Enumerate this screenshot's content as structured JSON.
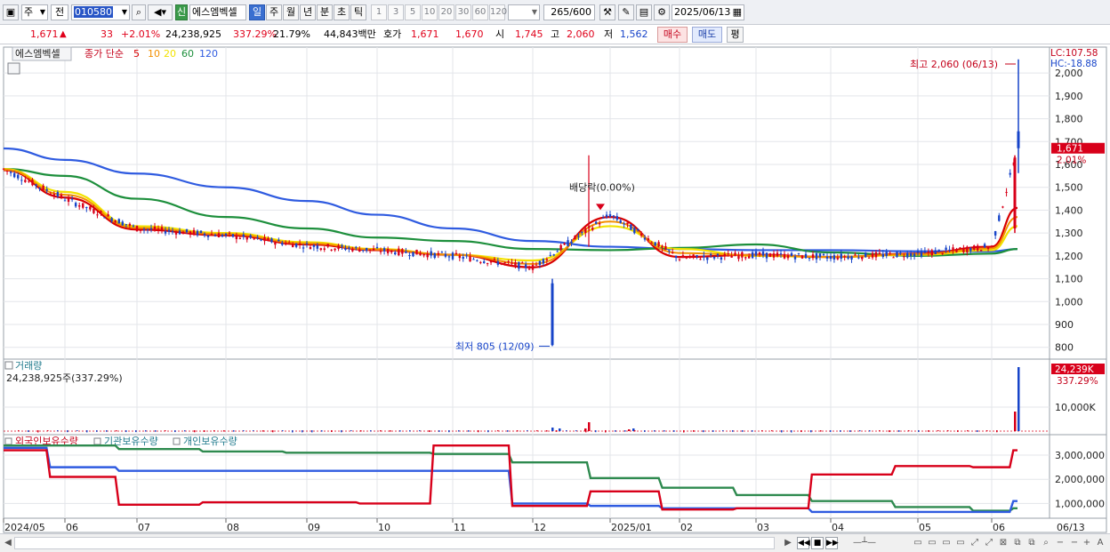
{
  "toolbar": {
    "market": "주",
    "scope": "전",
    "code": "010580",
    "badge": "신",
    "stock_name": "에스엠벡셀",
    "periods": [
      {
        "label": "일",
        "selected": true
      },
      {
        "label": "주",
        "selected": false
      },
      {
        "label": "월",
        "selected": false
      },
      {
        "label": "년",
        "selected": false
      },
      {
        "label": "분",
        "selected": false
      },
      {
        "label": "초",
        "selected": false
      },
      {
        "label": "틱",
        "selected": false
      }
    ],
    "intervals": [
      "1",
      "3",
      "5",
      "10",
      "20",
      "30",
      "60",
      "120"
    ],
    "count": "265/600",
    "date": "2025/06/13"
  },
  "quote": {
    "price": "1,671",
    "arrow": "▲",
    "change": "33",
    "change_pct": "+2.01%",
    "volume": "24,238,925",
    "volume_ratio": "337.29%",
    "turnover": "21.79%",
    "amount": "44,843백만",
    "ask_label": "호가",
    "ask": "1,671",
    "bid": "1,670",
    "open_label": "시",
    "open": "1,745",
    "high_label": "고",
    "high": "2,060",
    "low_label": "저",
    "low": "1,562",
    "buy_label": "매수",
    "sell_label": "매도",
    "avg_label": "평"
  },
  "colors": {
    "up": "#e0001a",
    "down": "#1744c9",
    "ma5": "#d80000",
    "ma10": "#f39000",
    "ma20": "#f2e200",
    "ma60": "#1d8f3c",
    "ma120": "#2f5be0"
  },
  "price_panel": {
    "legend_name": "에스엠벡셀",
    "legend_series": "종가 단순",
    "ma_periods": [
      "5",
      "10",
      "20",
      "60",
      "120"
    ],
    "lc": "LC:107.58",
    "hc": "HC:-18.88",
    "current_tag": "1,671",
    "current_pct": "2.01%",
    "high_note": "최고 2,060 (06/13)",
    "low_note": "최저 805 (12/09)",
    "dividend_note": "배당락(0.00%)",
    "y_ticks": [
      "2,000",
      "1,900",
      "1,800",
      "1,700",
      "1,600",
      "1,500",
      "1,400",
      "1,300",
      "1,200",
      "1,100",
      "1,000",
      "900",
      "800"
    ]
  },
  "volume_panel": {
    "title": "거래량",
    "summary": "24,238,925주(337.29%)",
    "tag": "24,239K",
    "tag_pct": "337.29%",
    "y_tick": "10,000K"
  },
  "holding_panel": {
    "legend": [
      "외국인보유수량",
      "기관보유수량",
      "개인보유수량"
    ],
    "y_ticks": [
      "3,000,000",
      "2,000,000",
      "1,000,000"
    ]
  },
  "x_axis": [
    "2024/05",
    "06",
    "07",
    "08",
    "09",
    "10",
    "11",
    "12",
    "2025/01",
    "02",
    "03",
    "04",
    "05",
    "06",
    "06/13"
  ],
  "chart_data": [
    {
      "type": "line",
      "name": "price",
      "x": [
        "2024/05",
        "06",
        "07",
        "08",
        "09",
        "10",
        "11",
        "12",
        "2025/01",
        "02",
        "03",
        "04",
        "05",
        "06",
        "06/13"
      ],
      "ylim": [
        760,
        2090
      ],
      "series": [
        {
          "name": "종가",
          "values": [
            1580,
            1450,
            1320,
            1290,
            1245,
            1225,
            1200,
            1150,
            1380,
            1190,
            1205,
            1195,
            1210,
            1240,
            1671
          ]
        },
        {
          "name": "5",
          "values": [
            1575,
            1455,
            1315,
            1290,
            1250,
            1225,
            1205,
            1150,
            1370,
            1195,
            1205,
            1195,
            1210,
            1240,
            1410
          ]
        },
        {
          "name": "20",
          "values": [
            1580,
            1480,
            1330,
            1300,
            1260,
            1230,
            1205,
            1180,
            1330,
            1230,
            1200,
            1195,
            1205,
            1225,
            1330
          ]
        },
        {
          "name": "60",
          "values": [
            1580,
            1550,
            1450,
            1370,
            1320,
            1280,
            1265,
            1230,
            1225,
            1235,
            1250,
            1215,
            1200,
            1210,
            1230
          ]
        },
        {
          "name": "120",
          "values": [
            1670,
            1620,
            1560,
            1500,
            1440,
            1380,
            1320,
            1265,
            1240,
            1230,
            1225,
            1225,
            1220,
            1220,
            1230
          ]
        }
      ],
      "annotations": [
        "최고 2,060 (06/13)",
        "최저 805 (12/09)",
        "배당락(0.00%)"
      ]
    },
    {
      "type": "line",
      "name": "holdings",
      "x": [
        "2024/05",
        "06",
        "07",
        "08",
        "09",
        "10",
        "11",
        "12",
        "2025/01",
        "02",
        "03",
        "04",
        "05",
        "06",
        "06/13"
      ],
      "ylim": [
        500000,
        3700000
      ],
      "series": [
        {
          "name": "외국인보유수량",
          "values": [
            3200000,
            2100000,
            950000,
            1050000,
            1050000,
            1000000,
            3400000,
            900000,
            1500000,
            750000,
            800000,
            2200000,
            2550000,
            2500000,
            3200000
          ]
        },
        {
          "name": "기관보유수량",
          "values": [
            3300000,
            2500000,
            2350000,
            2350000,
            2350000,
            2350000,
            2350000,
            1000000,
            900000,
            800000,
            800000,
            650000,
            650000,
            650000,
            1100000
          ]
        },
        {
          "name": "개인보유수량",
          "values": [
            3400000,
            3400000,
            3250000,
            3150000,
            3100000,
            3100000,
            3050000,
            2700000,
            2050000,
            1650000,
            1350000,
            1100000,
            850000,
            700000,
            800000
          ]
        }
      ]
    }
  ]
}
